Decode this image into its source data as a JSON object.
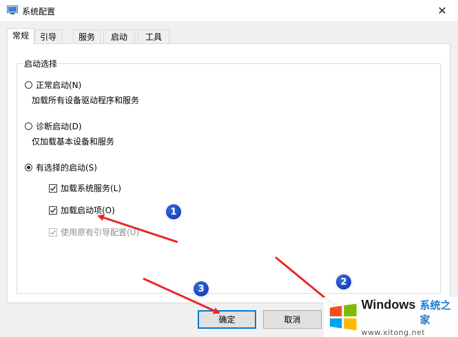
{
  "window": {
    "title": "系统配置",
    "close_glyph": "✕"
  },
  "tabs": [
    {
      "label": "常规",
      "active": true
    },
    {
      "label": "引导",
      "active": false
    },
    {
      "label": "服务",
      "active": false
    },
    {
      "label": "启动",
      "active": false
    },
    {
      "label": "工具",
      "active": false
    }
  ],
  "startup": {
    "group_title": "启动选择",
    "normal_label": "正常启动(N)",
    "normal_desc": "加载所有设备驱动程序和服务",
    "diagnostic_label": "诊断启动(D)",
    "diagnostic_desc": "仅加载基本设备和服务",
    "selective_label": "有选择的启动(S)",
    "selected": "selective",
    "options": {
      "load_services": {
        "label": "加载系统服务(L)",
        "checked": true
      },
      "load_startup": {
        "label": "加载启动项(O)",
        "checked": true
      },
      "use_original_boot": {
        "label": "使用原有引导配置(U)",
        "checked": true,
        "disabled": true
      }
    }
  },
  "buttons": {
    "ok": "确定",
    "cancel": "取消"
  },
  "annotations": {
    "badge1": "1",
    "badge2": "2",
    "badge3": "3",
    "arrow_color": "#e8262a",
    "badge_color": "#1a3fc4"
  },
  "watermark": {
    "brand": "Windows",
    "cn": "系统之家",
    "url": "www.xitong.net"
  }
}
